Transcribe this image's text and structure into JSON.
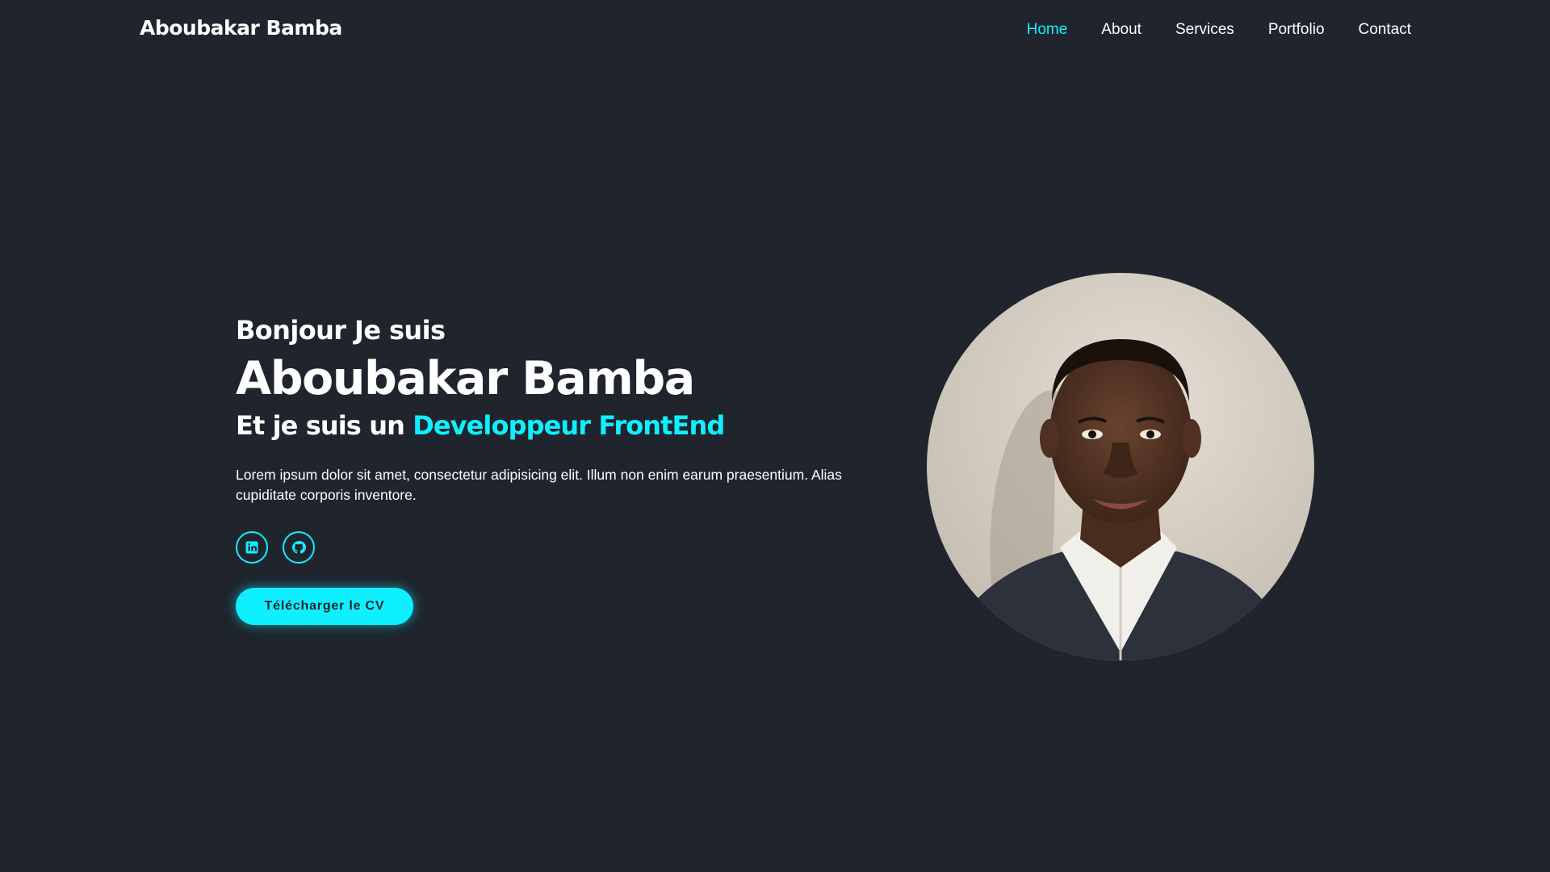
{
  "header": {
    "logo": "Aboubakar Bamba",
    "nav": [
      {
        "label": "Home",
        "active": true
      },
      {
        "label": "About",
        "active": false
      },
      {
        "label": "Services",
        "active": false
      },
      {
        "label": "Portfolio",
        "active": false
      },
      {
        "label": "Contact",
        "active": false
      }
    ]
  },
  "hero": {
    "greeting": "Bonjour Je suis",
    "name": "Aboubakar Bamba",
    "role_prefix": "Et je suis un ",
    "role_highlight": "Developpeur FrontEnd",
    "description": "Lorem ipsum dolor sit amet, consectetur adipisicing elit. Illum non enim earum praesentium. Alias cupiditate corporis inventore.",
    "socials": [
      {
        "icon": "linkedin-icon"
      },
      {
        "icon": "github-icon"
      }
    ],
    "cv_button": "Télécharger le CV"
  },
  "portrait": {
    "icon": "profile-photo"
  },
  "colors": {
    "background": "#1f242d",
    "accent": "#0ef0ff",
    "text": "#ffffff"
  }
}
